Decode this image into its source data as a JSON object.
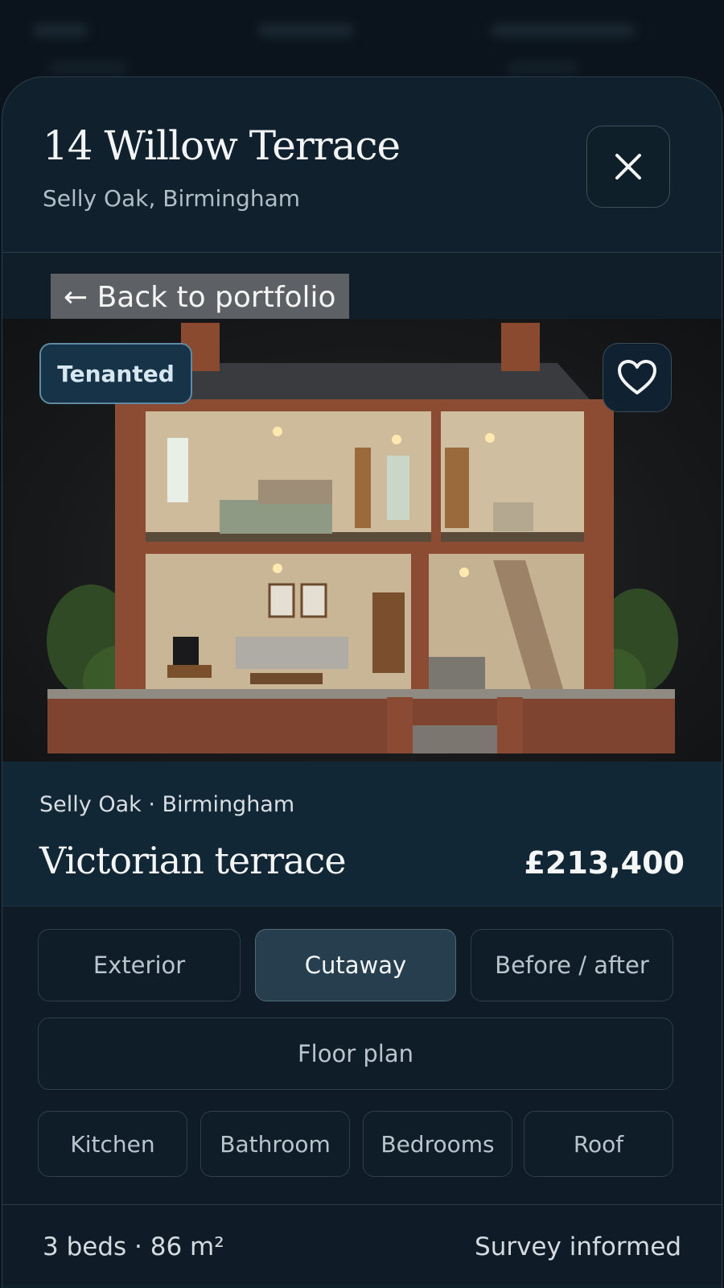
{
  "header": {
    "title": "14 Willow Terrace",
    "subtitle": "Selly Oak, Birmingham"
  },
  "icons": {
    "close": "close-icon",
    "favorite": "heart-icon",
    "back": "arrow-left-icon"
  },
  "back_link": "← Back to portfolio",
  "hero": {
    "status_badge": "Tenanted"
  },
  "property": {
    "location": "Selly Oak · Birmingham",
    "type": "Victorian terrace",
    "price": "£213,400"
  },
  "view_tabs": {
    "items": [
      "Exterior",
      "Cutaway",
      "Before / after",
      "Floor plan"
    ],
    "active": "Cutaway"
  },
  "room_chips": [
    "Kitchen",
    "Bathroom",
    "Bedrooms",
    "Roof"
  ],
  "footer": {
    "beds_area": "3 beds · 86 m²",
    "survey": "Survey informed"
  },
  "colors": {
    "background": "#0b141c",
    "sheet": "#10212d",
    "accent_badge": "#173347",
    "active_tab": "#263e4d"
  }
}
